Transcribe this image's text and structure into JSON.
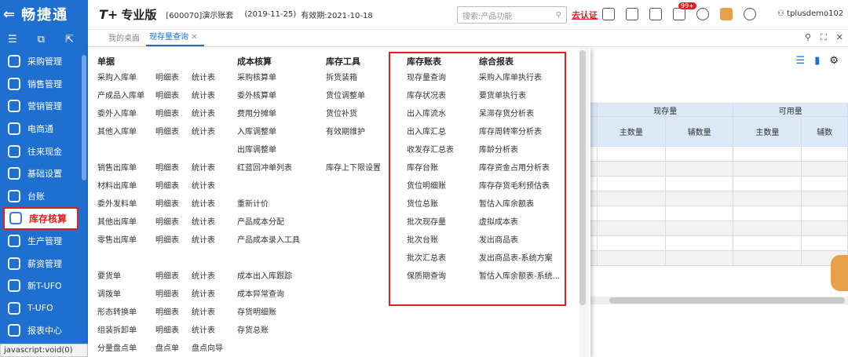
{
  "sidebar": {
    "logo": "畅捷通",
    "items": [
      {
        "label": "采购管理",
        "icon": "cart-icon"
      },
      {
        "label": "销售管理",
        "icon": "chart-icon"
      },
      {
        "label": "营销管理",
        "icon": "grid-icon"
      },
      {
        "label": "电商通",
        "icon": "ecommerce-icon"
      },
      {
        "label": "往来现金",
        "icon": "exchange-icon"
      },
      {
        "label": "基础设置",
        "icon": "gear-icon"
      },
      {
        "label": "台账",
        "icon": "ledger-icon"
      },
      {
        "label": "库存核算",
        "icon": "inventory-icon"
      },
      {
        "label": "生产管理",
        "icon": "factory-icon"
      },
      {
        "label": "薪资管理",
        "icon": "salary-icon"
      },
      {
        "label": "新T-UFO",
        "icon": "grid-icon"
      },
      {
        "label": "T-UFO",
        "icon": "ufo-icon"
      },
      {
        "label": "报表中心",
        "icon": "report-icon"
      }
    ],
    "status": "javascript:void(0)"
  },
  "topbar": {
    "brand": "T+",
    "edition": "专业版",
    "account": "[600070]演示账套",
    "date": "(2019-11-25)",
    "valid": "有效期:2021-10-18",
    "search_placeholder": "搜索:产品功能",
    "cert": "去认证",
    "badge": "99+",
    "user": "tplusdemo102"
  },
  "tabs": [
    {
      "label": "我的桌面"
    },
    {
      "label": "现存量查询"
    }
  ],
  "grid": {
    "col1": "现存量",
    "col2": "可用量",
    "sub1": "主数量",
    "sub2": "辅数量",
    "sub3": "主数量",
    "sub4": "辅数"
  },
  "menu": {
    "col1_title": "单据",
    "col1_rows": [
      [
        "采购入库单",
        "明细表",
        "统计表"
      ],
      [
        "产成品入库单",
        "明细表",
        "统计表"
      ],
      [
        "委外入库单",
        "明细表",
        "统计表"
      ],
      [
        "其他入库单",
        "明细表",
        "统计表"
      ],
      null,
      [
        "销售出库单",
        "明细表",
        "统计表"
      ],
      [
        "材料出库单",
        "明细表",
        "统计表"
      ],
      [
        "委外发料单",
        "明细表",
        "统计表"
      ],
      [
        "其他出库单",
        "明细表",
        "统计表"
      ],
      [
        "零售出库单",
        "明细表",
        "统计表"
      ],
      null,
      [
        "要货单",
        "明细表",
        "统计表"
      ],
      [
        "调拨单",
        "明细表",
        "统计表"
      ],
      [
        "形态转换单",
        "明细表",
        "统计表"
      ],
      [
        "组装拆卸单",
        "明细表",
        "统计表"
      ],
      [
        "分量盘点单",
        "盘点单",
        "盘点向导"
      ]
    ],
    "col2_title": "成本核算",
    "col2_rows": [
      "采购核算单",
      "委外核算单",
      "费用分摊单",
      "入库调整单",
      "出库调整单",
      "红蓝回冲单列表",
      null,
      "重新计价",
      "产品成本分配",
      "产品成本录入工具",
      null,
      "成本出入库跟踪",
      "成本异常查询",
      "存货明细账",
      "存货总账"
    ],
    "col3_title": "库存工具",
    "col3_rows": [
      "拆货装箱",
      "货位调整单",
      "货位补货",
      "有效期维护",
      null,
      "库存上下限设置"
    ],
    "col4_title": "库存账表",
    "col4_rows": [
      "现存量查询",
      "库存状况表",
      "出入库流水",
      "出入库汇总",
      "收发存汇总表",
      "库存台账",
      "货位明细账",
      "货位总账",
      "批次现存量",
      "批次台账",
      "批次汇总表",
      "保质期查询"
    ],
    "col5_title": "综合报表",
    "col5_rows": [
      "采购入库单执行表",
      "要货单执行表",
      "呆滞存货分析表",
      "库存周转率分析表",
      "库龄分析表",
      "库存资金占用分析表",
      "库存存货毛利预估表",
      "暂估入库余额表",
      "虚拟成本表",
      "发出商品表",
      "发出商品表-系统方案",
      "暂估入库余额表-系统..."
    ]
  }
}
